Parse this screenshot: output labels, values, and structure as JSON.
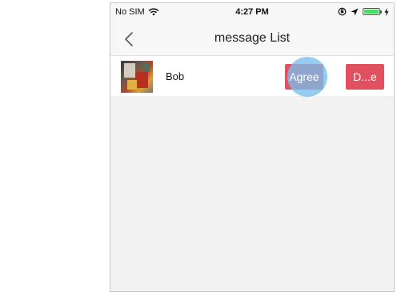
{
  "status_bar": {
    "carrier": "No SIM",
    "time": "4:27 PM"
  },
  "nav": {
    "title": "message List"
  },
  "messages": [
    {
      "name": "Bob",
      "agree_label": "Agree",
      "decline_label": "D...e"
    }
  ],
  "colors": {
    "action_button": "#e0505e",
    "tap_indicator": "#78bee b",
    "battery": "#4cd964"
  },
  "icons": [
    "wifi-icon",
    "lock-rotation-icon",
    "location-icon",
    "battery-icon",
    "charging-icon",
    "back-chevron-icon"
  ]
}
